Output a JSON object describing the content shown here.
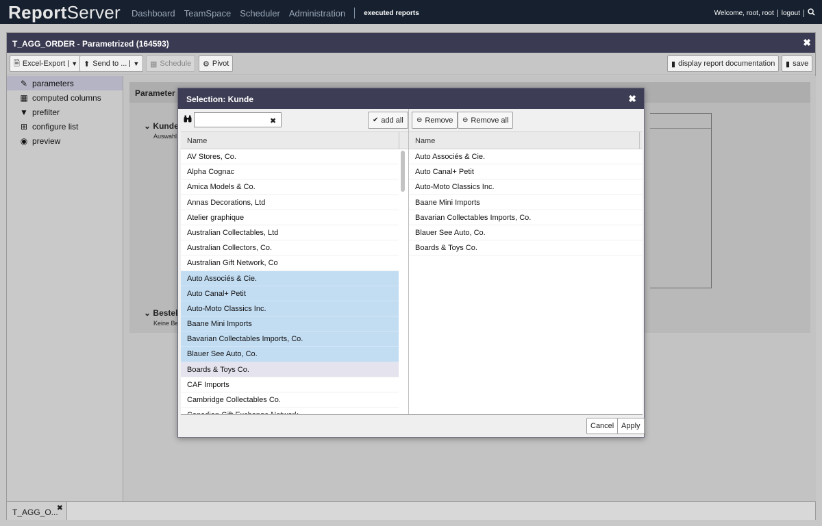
{
  "app": {
    "logo_bold": "Report",
    "logo_rest": "Server"
  },
  "nav": {
    "items": [
      "Dashboard",
      "TeamSpace",
      "Scheduler",
      "Administration"
    ],
    "active": "executed reports"
  },
  "user": {
    "welcome": "Welcome, root, root",
    "logout": "logout"
  },
  "window": {
    "title": "T_AGG_ORDER - Parametrized (164593)"
  },
  "toolbar": {
    "excel_export": "Excel-Export",
    "send_to": "Send to ...",
    "schedule": "Schedule",
    "pivot": "Pivot",
    "display_doc": "display report documentation",
    "save": "save"
  },
  "sidebar": {
    "items": [
      {
        "label": "parameters",
        "icon": "edit-icon"
      },
      {
        "label": "computed columns",
        "icon": "calculator-icon"
      },
      {
        "label": "prefilter",
        "icon": "filter-icon"
      },
      {
        "label": "configure list",
        "icon": "table-icon"
      },
      {
        "label": "preview",
        "icon": "eye-icon"
      }
    ]
  },
  "params": {
    "header": "Parameter s",
    "group1_title": "Kunde",
    "group1_sub": "Auswahl",
    "group2_title": "Bestell",
    "group2_sub": "Keine Be"
  },
  "bottom_tab": {
    "label": "T_AGG_O..."
  },
  "modal": {
    "title": "Selection: Kunde",
    "search_value": "",
    "add_all": "add all",
    "remove": "Remove",
    "remove_all": "Remove all",
    "left_column_header": "Name",
    "right_column_header": "Name",
    "available": [
      "AV Stores, Co.",
      "Alpha Cognac",
      "Amica Models & Co.",
      "Annas Decorations, Ltd",
      "Atelier graphique",
      "Australian Collectables, Ltd",
      "Australian Collectors, Co.",
      "Australian Gift Network, Co",
      "Auto Associés & Cie.",
      "Auto Canal+ Petit",
      "Auto-Moto Classics Inc.",
      "Baane Mini Imports",
      "Bavarian Collectables Imports, Co.",
      "Blauer See Auto, Co.",
      "Boards & Toys Co.",
      "CAF Imports",
      "Cambridge Collectables Co.",
      "Canadian Gift Exchange Network"
    ],
    "selected": [
      "Auto Associés & Cie.",
      "Auto Canal+ Petit",
      "Auto-Moto Classics Inc.",
      "Baane Mini Imports",
      "Bavarian Collectables Imports, Co.",
      "Blauer See Auto, Co.",
      "Boards & Toys Co."
    ],
    "cancel": "Cancel",
    "apply": "Apply"
  }
}
